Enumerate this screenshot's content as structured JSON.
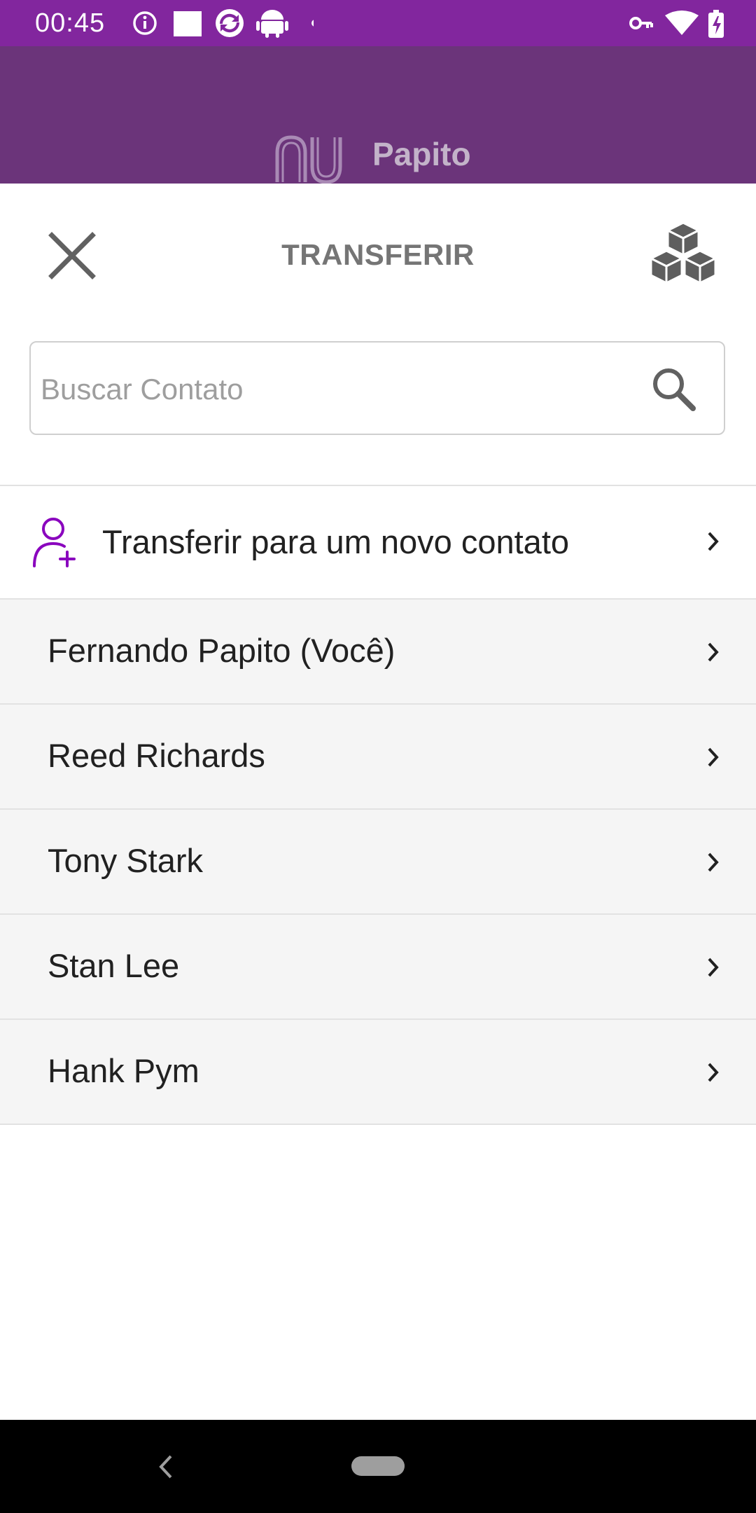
{
  "status_bar": {
    "time": "00:45",
    "left_icons": [
      "info-icon",
      "square-icon",
      "sync-icon",
      "android-icon",
      "dot-icon"
    ],
    "right_icons": [
      "vpn-key-icon",
      "wifi-icon",
      "battery-charging-icon"
    ]
  },
  "header": {
    "brand_logo": "nu-logo",
    "account_name": "Papito"
  },
  "sheet": {
    "title": "TRANSFERIR",
    "close_icon": "close-icon",
    "action_icon": "cubes-icon"
  },
  "search": {
    "placeholder": "Buscar Contato",
    "value": ""
  },
  "new_contact": {
    "label": "Transferir para um novo contato",
    "icon": "add-person-icon"
  },
  "contacts": [
    {
      "name": "Fernando Papito (Você)"
    },
    {
      "name": "Reed Richards"
    },
    {
      "name": "Tony Stark"
    },
    {
      "name": "Stan Lee"
    },
    {
      "name": "Hank Pym"
    }
  ],
  "colors": {
    "status_bar": "#82269e",
    "header_band": "#6b347a",
    "accent": "#8a05be",
    "row_background": "#f5f5f5",
    "title_gray": "#757575"
  }
}
